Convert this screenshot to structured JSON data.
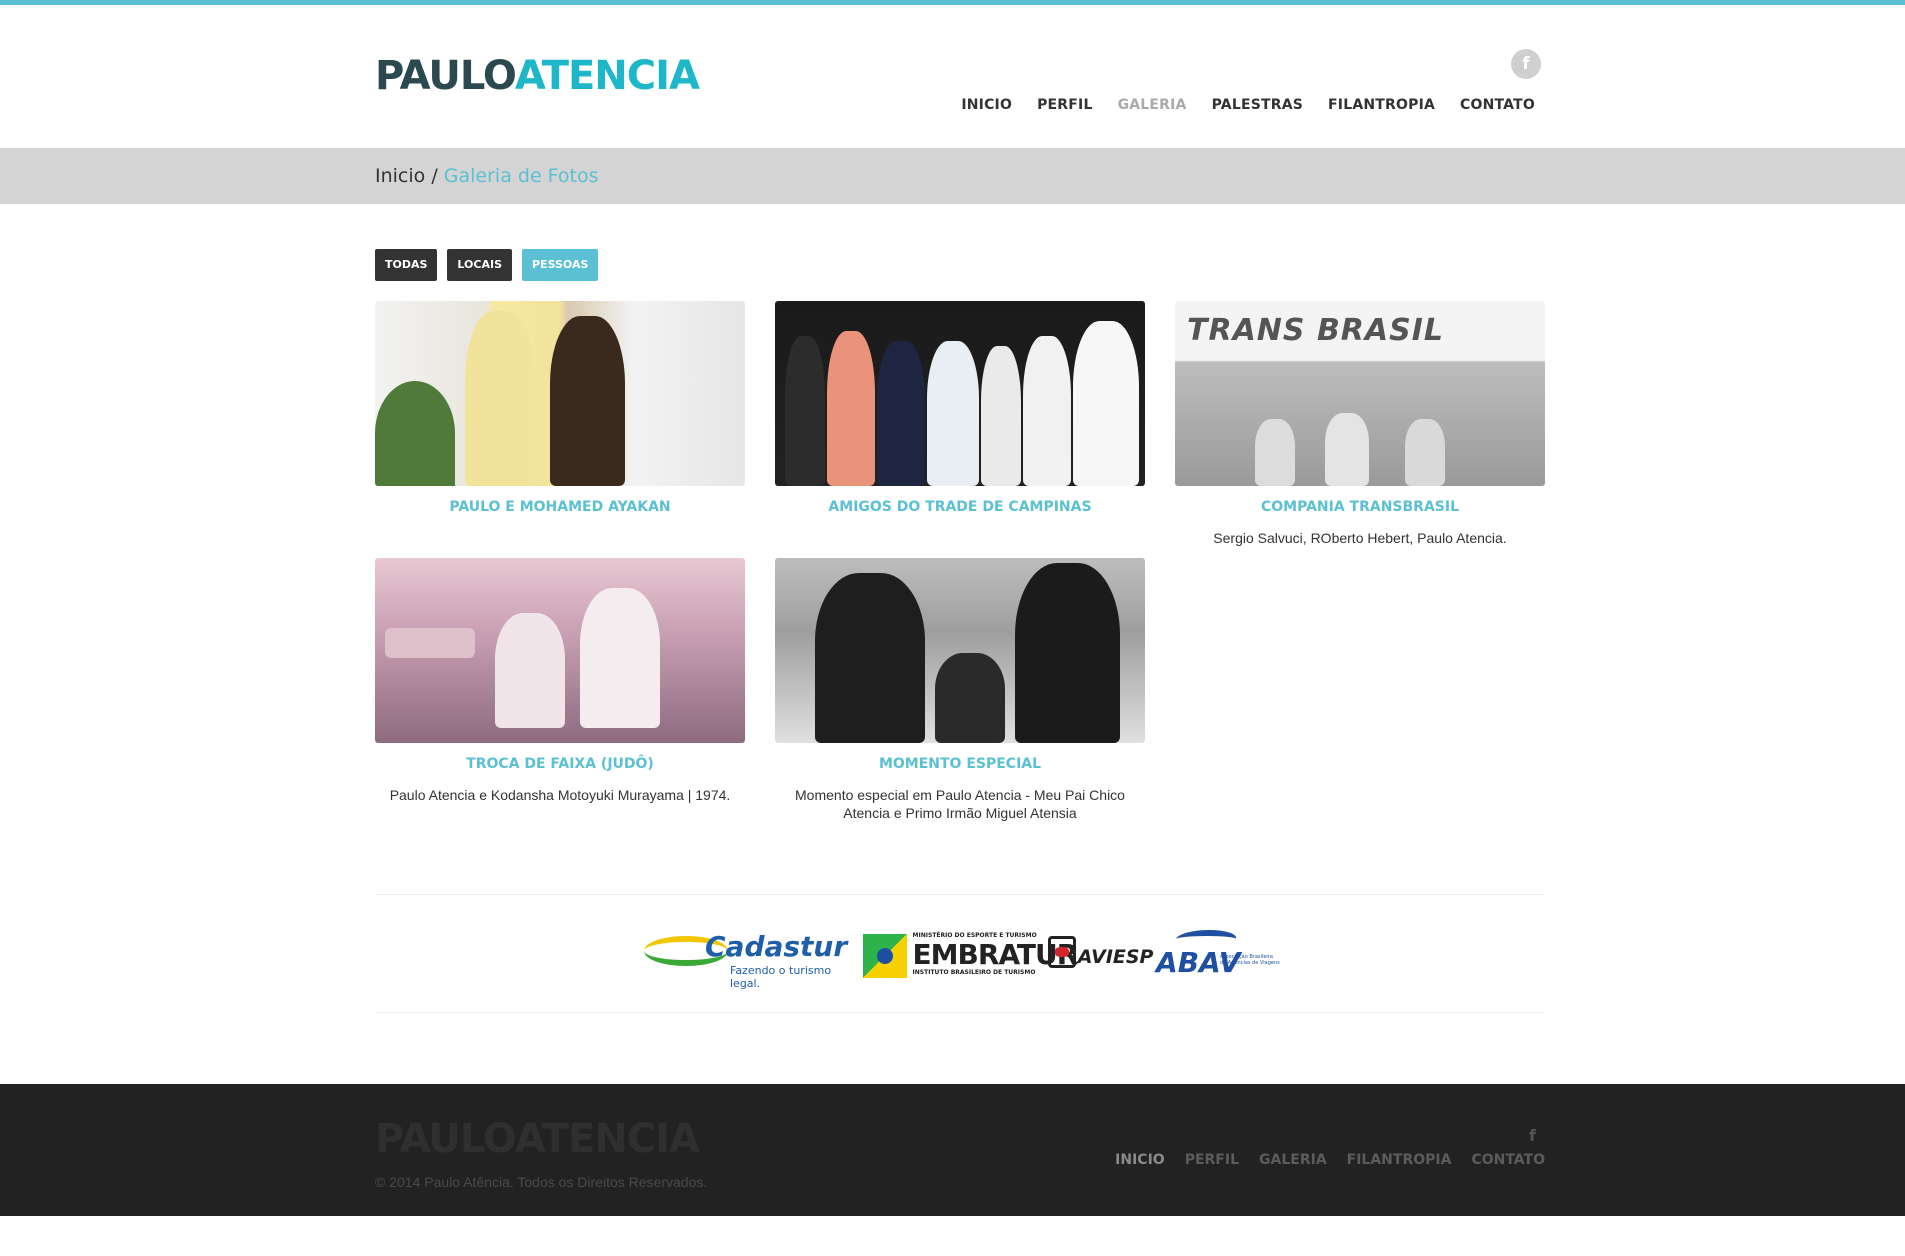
{
  "header": {
    "logo_part1": "PAULO",
    "logo_part2": "ATENCIA",
    "social_icon": "facebook-icon",
    "social_glyph": "f",
    "nav": [
      "INICIO",
      "PERFIL",
      "GALERIA",
      "PALESTRAS",
      "FILANTROPIA",
      "CONTATO"
    ],
    "active_nav": "GALERIA"
  },
  "breadcrumb": {
    "home": "Inicio",
    "separator": "/",
    "current": "Galeria de Fotos"
  },
  "filters": {
    "items": [
      "TODAS",
      "LOCAIS",
      "PESSOAS"
    ],
    "selected": "PESSOAS"
  },
  "gallery": [
    {
      "title": "PAULO E MOHAMED AYAKAN",
      "description": ""
    },
    {
      "title": "AMIGOS DO TRADE DE CAMPINAS",
      "description": ""
    },
    {
      "title": "COMPANIA TRANSBRASIL",
      "description": "Sergio Salvuci, ROberto Hebert, Paulo Atencia.",
      "photo_text": "TRANS BRASIL"
    },
    {
      "title": "TROCA DE FAIXA (JUDÔ)",
      "description": "Paulo Atencia e Kodansha Motoyuki Murayama | 1974."
    },
    {
      "title": "MOMENTO ESPECIAL",
      "description": "Momento especial em Paulo Atencia - Meu Pai Chico Atencia e Primo Irmão Miguel Atensia"
    }
  ],
  "partners": {
    "cadastur": {
      "name": "Cadastur",
      "tagline": "Fazendo o turismo legal."
    },
    "embratur": {
      "ministry": "MINISTÉRIO DO ESPORTE E TURISMO",
      "name": "EMBRATUR",
      "sub": "INSTITUTO BRASILEIRO DE TURISMO"
    },
    "aviesp": {
      "name": "AVIESP"
    },
    "abav": {
      "name": "ABAV",
      "sub": "Associação Brasileira de Agências de Viagens"
    }
  },
  "footer": {
    "logo": "PAULOATENCIA",
    "copyright": "© 2014 Paulo Atência. Todos os Direitos Reservados.",
    "social_glyph": "f",
    "nav": [
      "INICIO",
      "PERFIL",
      "GALERIA",
      "FILANTROPIA",
      "CONTATO"
    ],
    "active_nav": "INICIO"
  },
  "colors": {
    "accent": "#5bc0d3",
    "logo_dark": "#2b4a50",
    "logo_accent": "#1eb7c9",
    "footer_bg": "#222222",
    "breadcrumb_bg": "#d4d4d4"
  }
}
